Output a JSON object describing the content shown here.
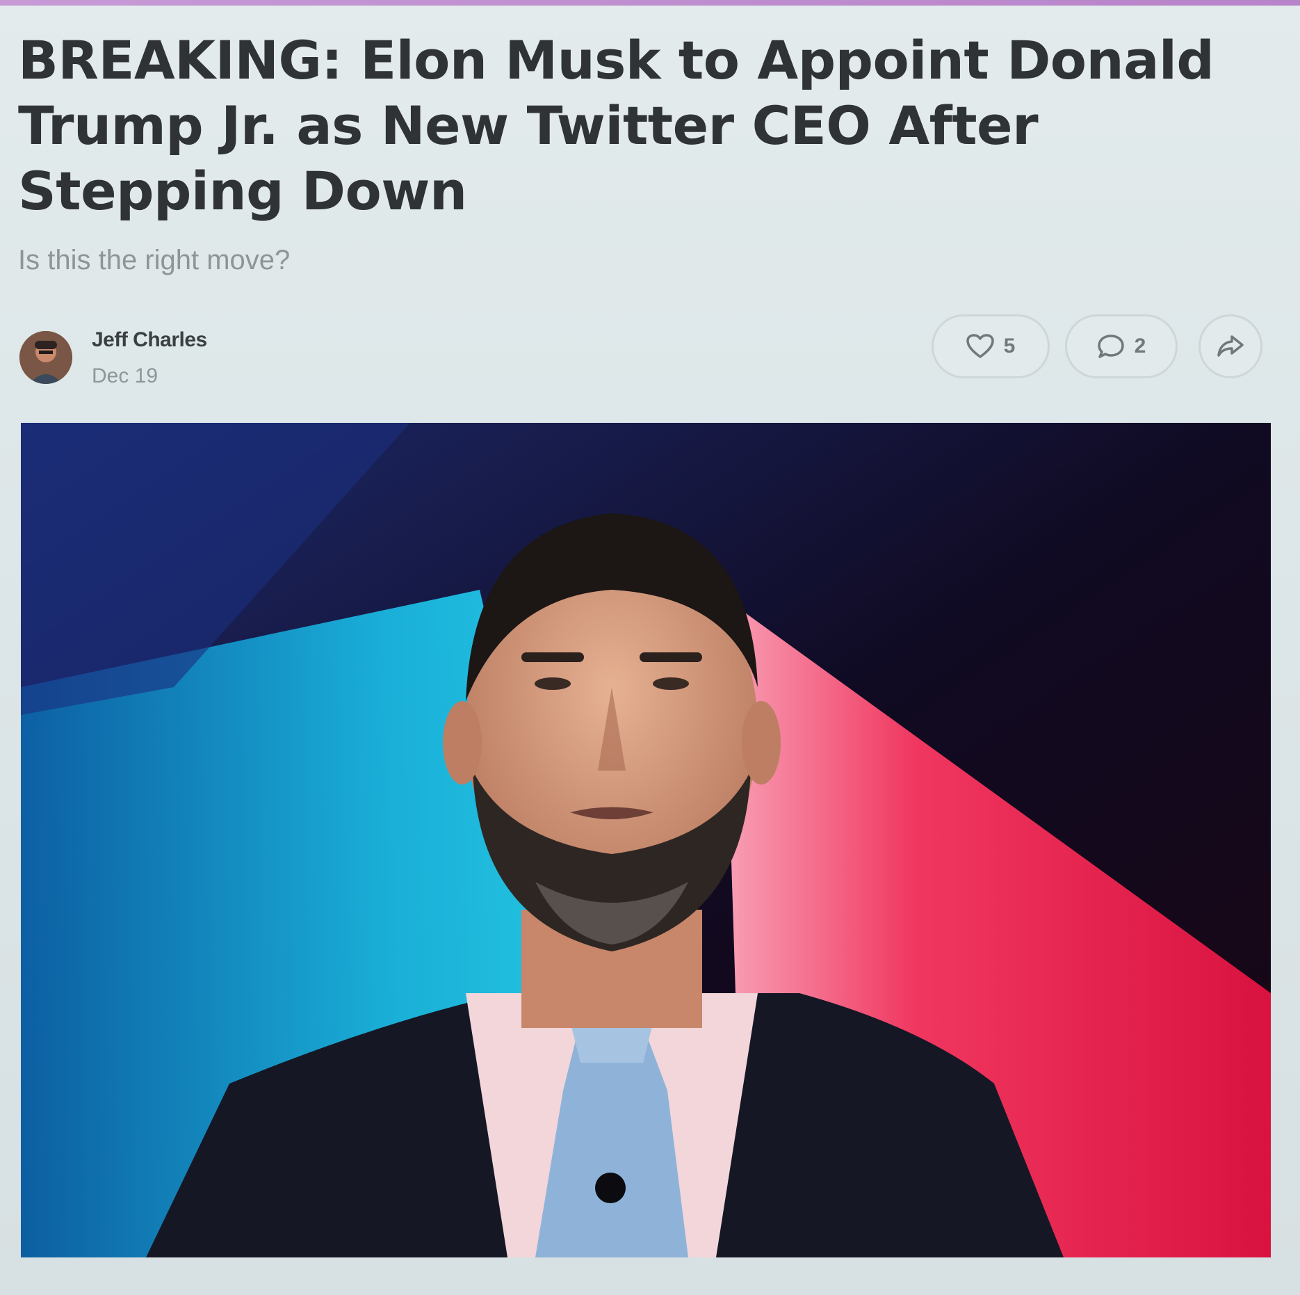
{
  "article": {
    "title": "BREAKING: Elon Musk to Appoint Donald Trump Jr. as New Twitter CEO After Stepping Down",
    "subtitle": "Is this the right move?",
    "author": {
      "name": "Jeff Charles",
      "date": "Dec 19"
    },
    "actions": {
      "like_count": "5",
      "comment_count": "2"
    }
  },
  "colors": {
    "title": "#2f3335",
    "subtitle": "#8d9597",
    "background": "#dde6e8",
    "accent": "#b783c9"
  },
  "icons": {
    "like": "heart-icon",
    "comment": "comment-bubble-icon",
    "share": "share-arrow-icon"
  }
}
